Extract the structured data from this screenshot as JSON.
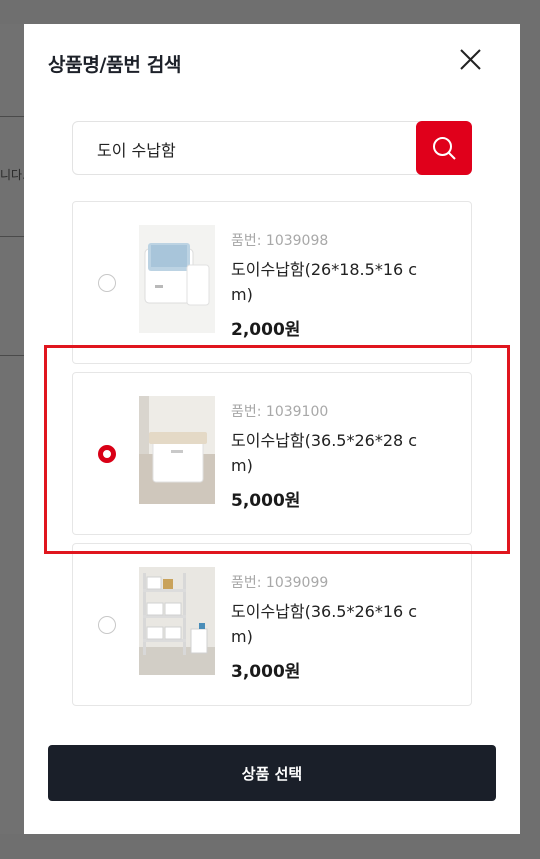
{
  "background": {
    "partial_text": "니다."
  },
  "modal": {
    "title": "상품명/품번 검색",
    "search": {
      "value": "도이 수납함"
    },
    "items": [
      {
        "code": "품번: 1039098",
        "name": "도이수납함(26*18.5*16 c m)",
        "price": "2,000원",
        "selected": false
      },
      {
        "code": "품번: 1039100",
        "name": "도이수납함(36.5*26*28 c m)",
        "price": "5,000원",
        "selected": true
      },
      {
        "code": "품번: 1039099",
        "name": "도이수납함(36.5*26*16 c m)",
        "price": "3,000원",
        "selected": false
      }
    ],
    "select_label": "상품 선택"
  },
  "colors": {
    "accent": "#e0001b",
    "button_dark": "#1a1f29",
    "highlight": "#e0161e"
  },
  "icons": {
    "close": "close-icon",
    "search": "search-icon"
  }
}
